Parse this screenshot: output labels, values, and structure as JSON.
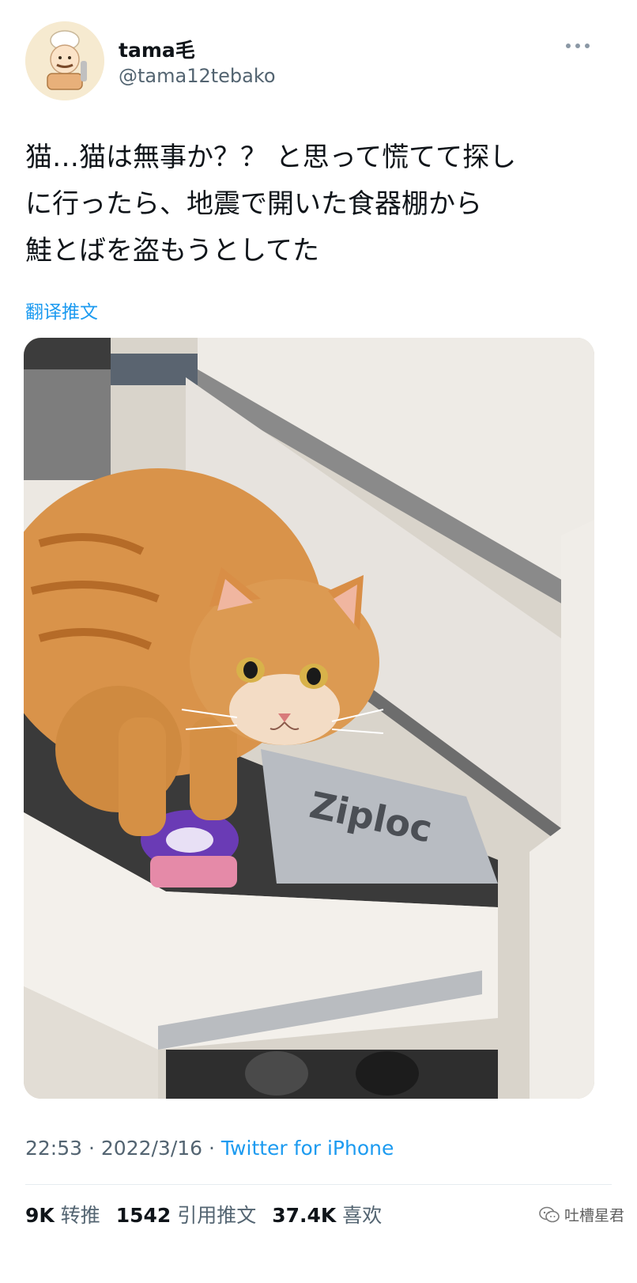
{
  "author": {
    "name": "tama毛",
    "handle": "@tama12tebako"
  },
  "tweet": {
    "text": "猫…猫は無事か？？ と思って慌てて探し\nに行ったら、地震で開いた食器棚から\n鮭とばを盗もうとしてた",
    "translate_label": "翻译推文",
    "photo_brand_text": "Ziploc"
  },
  "meta": {
    "time": "22:53",
    "separator": " · ",
    "date": "2022/3/16",
    "source": "Twitter for iPhone"
  },
  "stats": {
    "retweets_count": "9K",
    "retweets_label": "转推",
    "quotes_count": "1542",
    "quotes_label": "引用推文",
    "likes_count": "37.4K",
    "likes_label": "喜欢"
  },
  "watermark": {
    "text": "吐槽星君"
  },
  "colors": {
    "link": "#1d9bf0",
    "secondary_text": "#536471",
    "primary_text": "#0f1419"
  },
  "icons": {
    "more": "more-dots-icon",
    "watermark": "wechat-icon"
  }
}
